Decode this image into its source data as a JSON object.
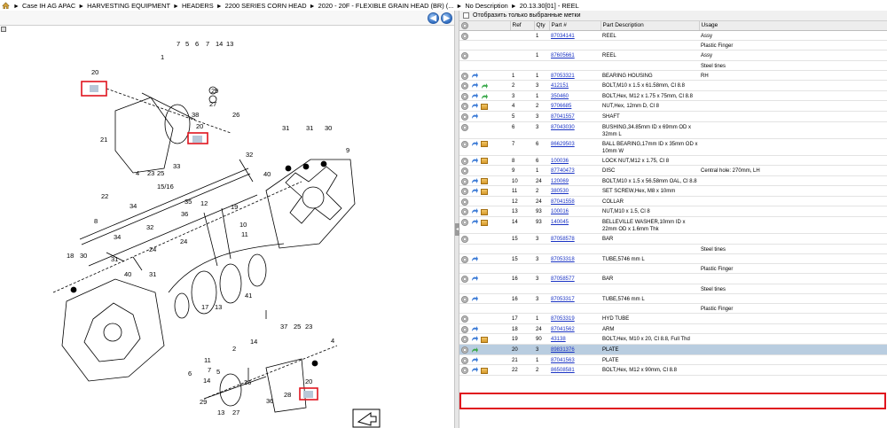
{
  "breadcrumb": [
    "Case IH AG APAC",
    "HARVESTING EQUIPMENT",
    "HEADERS",
    "2200 SERIES CORN HEAD",
    "2020 - 20F - FLEXIBLE GRAIN HEAD (BR) (...",
    "No Description",
    "20.13.30[01] - REEL"
  ],
  "breadcrumb_separator": "►",
  "nav": {
    "back_glyph": "◀",
    "forward_glyph": "▶"
  },
  "filter_label": "Отобразить только выбранные метки",
  "columns": [
    "",
    "Ref",
    "Qty",
    "Part #",
    "Part Description",
    "Usage"
  ],
  "diagram_callouts": [
    "7",
    "5",
    "6",
    "7",
    "14",
    "13",
    "1",
    "20",
    "29",
    "27",
    "26",
    "38",
    "20",
    "21",
    "4",
    "23",
    "25",
    "33",
    "22",
    "31",
    "31",
    "30",
    "9",
    "34",
    "40",
    "15/16",
    "35",
    "12",
    "32",
    "36",
    "19",
    "24",
    "10",
    "11",
    "8",
    "34",
    "32",
    "24",
    "18",
    "30",
    "31",
    "40",
    "31",
    "41",
    "17",
    "13",
    "14",
    "2",
    "37",
    "25",
    "23",
    "4",
    "11",
    "7",
    "5",
    "6",
    "14",
    "29",
    "13",
    "27",
    "26",
    "36",
    "28",
    "20"
  ],
  "splitter_glyph": "◂",
  "rows": [
    {
      "icons": [
        "gear"
      ],
      "ref": "",
      "qty": "1",
      "part": "87034141",
      "desc": "REEL",
      "usage": "Assy"
    },
    {
      "icons": [],
      "ref": "",
      "qty": "",
      "part": "",
      "desc": "",
      "usage": "Plastic Finger"
    },
    {
      "icons": [
        "gear"
      ],
      "ref": "",
      "qty": "1",
      "part": "87605661",
      "desc": "REEL",
      "usage": "Assy"
    },
    {
      "icons": [],
      "ref": "",
      "qty": "",
      "part": "",
      "desc": "",
      "usage": "Steel tines"
    },
    {
      "icons": [
        "gear",
        "blue"
      ],
      "ref": "1",
      "qty": "1",
      "part": "87053321",
      "desc": "BEARING HOUSING",
      "usage": "RH"
    },
    {
      "icons": [
        "gear",
        "blue",
        "green"
      ],
      "ref": "2",
      "qty": "3",
      "part": "412151",
      "desc": "BOLT,M10 x 1.5 x 61.58mm, Cl 8.8",
      "usage": ""
    },
    {
      "icons": [
        "gear",
        "blue",
        "green"
      ],
      "ref": "3",
      "qty": "1",
      "part": "350460",
      "desc": "BOLT,Hex, M12 x 1.75 x 75mm, Cl 8.8",
      "usage": ""
    },
    {
      "icons": [
        "gear",
        "blue",
        "box"
      ],
      "ref": "4",
      "qty": "2",
      "part": "9706685",
      "desc": "NUT,Hex, 12mm D, Cl 8",
      "usage": ""
    },
    {
      "icons": [
        "gear",
        "blue"
      ],
      "ref": "5",
      "qty": "3",
      "part": "87041557",
      "desc": "SHAFT",
      "usage": ""
    },
    {
      "icons": [
        "gear"
      ],
      "ref": "6",
      "qty": "3",
      "part": "87043030",
      "desc": "BUSHING,34.85mm ID x 69mm OD x 32mm L",
      "usage": ""
    },
    {
      "icons": [
        "gear",
        "blue",
        "box"
      ],
      "ref": "7",
      "qty": "6",
      "part": "86629503",
      "desc": "BALL BEARING,17mm ID x 35mm OD x 10mm W",
      "usage": ""
    },
    {
      "icons": [
        "gear",
        "blue",
        "box"
      ],
      "ref": "8",
      "qty": "6",
      "part": "100036",
      "desc": "LOCK NUT,M12 x 1.75, Cl 8",
      "usage": ""
    },
    {
      "icons": [
        "gear"
      ],
      "ref": "9",
      "qty": "1",
      "part": "87740473",
      "desc": "DISC",
      "usage": "Central hole: 270mm, LH"
    },
    {
      "icons": [
        "gear",
        "blue",
        "box"
      ],
      "ref": "10",
      "qty": "24",
      "part": "120069",
      "desc": "BOLT,M10 x 1.5 x 56.58mm OAL, Cl 8.8",
      "usage": ""
    },
    {
      "icons": [
        "gear",
        "blue",
        "box"
      ],
      "ref": "11",
      "qty": "2",
      "part": "380530",
      "desc": "SET SCREW,Hex, M8 x 10mm",
      "usage": ""
    },
    {
      "icons": [
        "gear"
      ],
      "ref": "12",
      "qty": "24",
      "part": "87041558",
      "desc": "COLLAR",
      "usage": ""
    },
    {
      "icons": [
        "gear",
        "blue",
        "box"
      ],
      "ref": "13",
      "qty": "93",
      "part": "100016",
      "desc": "NUT,M10 x 1.5, Cl 8",
      "usage": ""
    },
    {
      "icons": [
        "gear",
        "blue",
        "box"
      ],
      "ref": "14",
      "qty": "93",
      "part": "140045",
      "desc": "BELLEVILLE WASHER,10mm ID x 22mm OD x 1.6mm Thk",
      "usage": ""
    },
    {
      "icons": [
        "gear"
      ],
      "ref": "15",
      "qty": "3",
      "part": "87058578",
      "desc": "BAR",
      "usage": ""
    },
    {
      "icons": [],
      "ref": "",
      "qty": "",
      "part": "",
      "desc": "",
      "usage": "Steel tines"
    },
    {
      "icons": [
        "gear",
        "blue"
      ],
      "ref": "15",
      "qty": "3",
      "part": "87053318",
      "desc": "TUBE,5746 mm L",
      "usage": ""
    },
    {
      "icons": [],
      "ref": "",
      "qty": "",
      "part": "",
      "desc": "",
      "usage": "Plastic Finger"
    },
    {
      "icons": [
        "gear",
        "blue"
      ],
      "ref": "16",
      "qty": "3",
      "part": "87058577",
      "desc": "BAR",
      "usage": ""
    },
    {
      "icons": [],
      "ref": "",
      "qty": "",
      "part": "",
      "desc": "",
      "usage": "Steel tines"
    },
    {
      "icons": [
        "gear",
        "blue"
      ],
      "ref": "16",
      "qty": "3",
      "part": "87053317",
      "desc": "TUBE,5746 mm L",
      "usage": ""
    },
    {
      "icons": [],
      "ref": "",
      "qty": "",
      "part": "",
      "desc": "",
      "usage": "Plastic Finger"
    },
    {
      "icons": [
        "gear"
      ],
      "ref": "17",
      "qty": "1",
      "part": "87053319",
      "desc": "HYD TUBE",
      "usage": ""
    },
    {
      "icons": [
        "gear",
        "blue"
      ],
      "ref": "18",
      "qty": "24",
      "part": "87041562",
      "desc": "ARM",
      "usage": ""
    },
    {
      "icons": [
        "gear",
        "blue",
        "box"
      ],
      "ref": "19",
      "qty": "90",
      "part": "43138",
      "desc": "BOLT,Hex, M10 x 20, Cl 8.8, Full Thd",
      "usage": ""
    },
    {
      "icons": [
        "gear",
        "green"
      ],
      "ref": "20",
      "qty": "3",
      "part": "89831376",
      "desc": "PLATE",
      "usage": "",
      "selected": true
    },
    {
      "icons": [
        "gear",
        "blue"
      ],
      "ref": "21",
      "qty": "1",
      "part": "87041563",
      "desc": "PLATE",
      "usage": ""
    },
    {
      "icons": [
        "gear",
        "blue",
        "box"
      ],
      "ref": "22",
      "qty": "2",
      "part": "86508581",
      "desc": "BOLT,Hex, M12 x 90mm, Cl 8.8",
      "usage": ""
    }
  ]
}
